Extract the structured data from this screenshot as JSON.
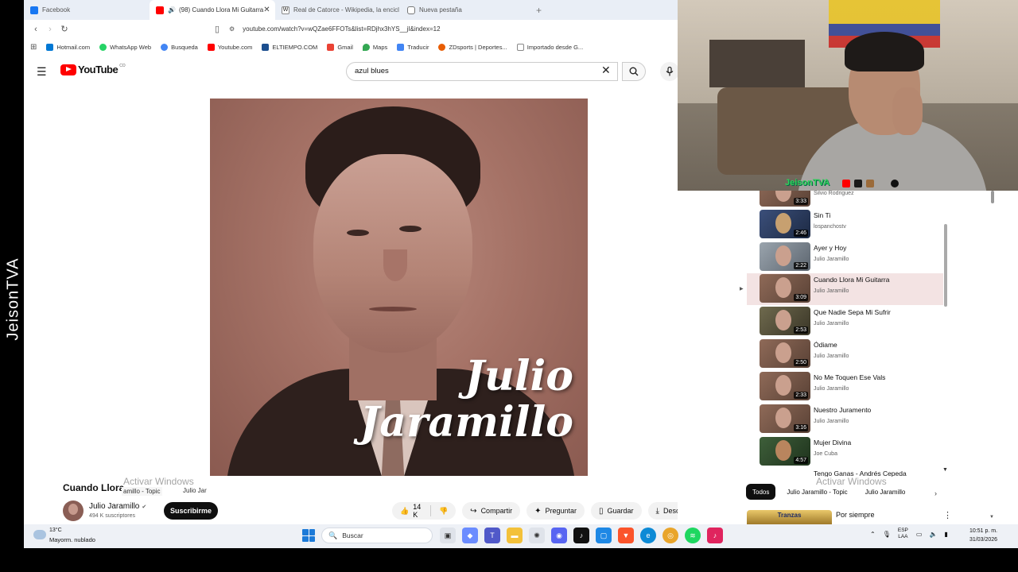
{
  "watermark_side": "JeisonTVA",
  "browser": {
    "tabs": [
      {
        "label": "Facebook",
        "color": "#1877f2"
      },
      {
        "label": "(98) Cuando Llora Mi Guitarra",
        "color": "#ff0000"
      },
      {
        "label": "Real de Catorce - Wikipedia, la encicl",
        "color": "#555555"
      },
      {
        "label": "Nueva pestaña",
        "color": "#777777"
      }
    ],
    "url": "youtube.com/watch?v=wQZae6FFOTs&list=RDjhx3hYS__jI&index=12",
    "bookmarks": [
      {
        "label": "Hotmail.com",
        "color": "#0078d4"
      },
      {
        "label": "WhatsApp Web",
        "color": "#25d366"
      },
      {
        "label": "Busqueda",
        "color": "#4285f4"
      },
      {
        "label": "Youtube.com",
        "color": "#ff0000"
      },
      {
        "label": "ELTIEMPO.COM",
        "color": "#1c4f8f"
      },
      {
        "label": "Gmail",
        "color": "#ea4335"
      },
      {
        "label": "Maps",
        "color": "#34a853"
      },
      {
        "label": "Traducir",
        "color": "#4285f4"
      },
      {
        "label": "ZDsports | Deportes...",
        "color": "#e85d04"
      },
      {
        "label": "Importado desde G...",
        "color": "#888888"
      }
    ]
  },
  "youtube": {
    "logo_text": "YouTube",
    "country_code": "CO",
    "search_value": "azul blues",
    "video_overlay_line1": "Julio",
    "video_overlay_line2": "Jaramillo",
    "video_title": "Cuando Llora",
    "overlap_text_1": "amillo - Topic",
    "overlap_text_2": "Julio Jar",
    "activate_windows": "Activar Windows",
    "channel_name": "Julio Jaramillo",
    "verified_icon": "✔",
    "subscribers": "494 K suscriptores",
    "subscribe_label": "Suscribirme",
    "like_count": "14 K",
    "share_label": "Compartir",
    "ask_label": "Preguntar",
    "save_label": "Guardar",
    "download_label": "Descargar"
  },
  "webcam": {
    "brand": "JeisonTVA"
  },
  "playlist": [
    {
      "title": "",
      "channel": "Silvio Rodriguez",
      "duration": "3:33"
    },
    {
      "title": "Sin Ti",
      "channel": "lospanchostv",
      "duration": "2:46"
    },
    {
      "title": "Ayer y Hoy",
      "channel": "Julio Jaramillo",
      "duration": "2:22"
    },
    {
      "title": "Cuando Llora Mi Guitarra",
      "channel": "Julio Jaramillo",
      "duration": "3:09",
      "current": true
    },
    {
      "title": "Que Nadie Sepa Mi Sufrir",
      "channel": "Julio Jaramillo",
      "duration": "2:53"
    },
    {
      "title": "Ódiame",
      "channel": "Julio Jaramillo",
      "duration": "2:50"
    },
    {
      "title": "No Me Toquen Ese Vals",
      "channel": "Julio Jaramillo",
      "duration": "2:33"
    },
    {
      "title": "Nuestro Juramento",
      "channel": "Julio Jaramillo",
      "duration": "3:16"
    },
    {
      "title": "Mujer Divina",
      "channel": "Joe Cuba",
      "duration": "4:57"
    },
    {
      "title": "Tengo Ganas - Andrés Cepeda",
      "channel": "",
      "duration": ""
    }
  ],
  "filters": {
    "chips": [
      "Todos",
      "Julio Jaramillo - Topic",
      "Julio Jaramillo"
    ],
    "activate_windows": "Activar Windows"
  },
  "next_card": {
    "thumb_text": "Tranzas",
    "title": "Por siempre"
  },
  "taskbar": {
    "temperature": "13°C",
    "weather": "Mayorm. nublado",
    "search_placeholder": "Buscar",
    "lang_line1": "ESP",
    "lang_line2": "LAA",
    "time": "10:51 p. m.",
    "date": "31/03/2026"
  }
}
